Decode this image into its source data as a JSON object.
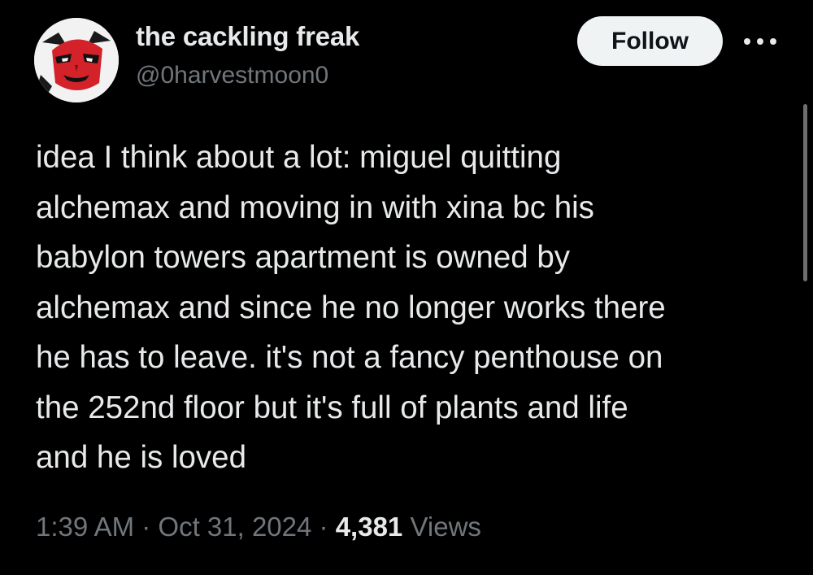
{
  "author": {
    "display_name": "the cackling freak",
    "handle": "@0harvestmoon0",
    "avatar_icon": "red-masked-face-avatar"
  },
  "actions": {
    "follow_label": "Follow",
    "more_icon": "more-horizontal-icon"
  },
  "tweet": {
    "lines": [
      "idea I think about a lot: miguel quitting",
      "alchemax and moving in with xina bc his",
      "babylon towers apartment is owned by",
      "alchemax and since he no longer works there",
      "he has to leave. it's not a fancy penthouse on",
      "the 252nd floor but it's full of plants and life",
      "and he is loved"
    ]
  },
  "meta": {
    "time": "1:39 AM",
    "separator": " · ",
    "date": "Oct 31, 2024",
    "views_count": "4,381",
    "views_label": " Views"
  },
  "colors": {
    "background": "#000000",
    "primary_text": "#e7e9ea",
    "secondary_text": "#71767b",
    "follow_bg": "#eff3f4",
    "follow_text": "#0f1419"
  }
}
